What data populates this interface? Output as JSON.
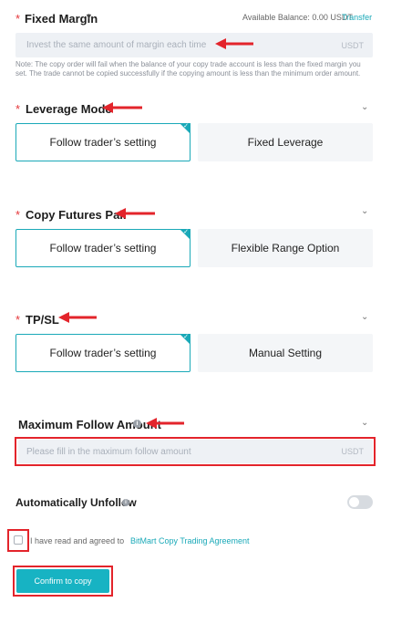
{
  "fixed_margin": {
    "label": "Fixed Margin",
    "dropdown_icon": "caret-down-icon",
    "balance_label": "Available Balance: 0.00 USDT",
    "transfer_link": "Transfer",
    "placeholder": "Invest the same amount of margin each time",
    "unit": "USDT",
    "note": "Note: The copy order will fail when the balance of your copy trade account is less than the fixed margin you set. The trade cannot be copied successfully if the copying amount is less than the minimum order amount."
  },
  "leverage_mode": {
    "label": "Leverage Mode",
    "options": [
      "Follow trader’s setting",
      "Fixed Leverage"
    ],
    "selected": 0
  },
  "copy_futures_pair": {
    "label": "Copy Futures Pair",
    "options": [
      "Follow trader’s setting",
      "Flexible Range Option"
    ],
    "selected": 0
  },
  "tpsl": {
    "label": "TP/SL",
    "options": [
      "Follow trader’s setting",
      "Manual Setting"
    ],
    "selected": 0
  },
  "max_follow": {
    "label": "Maximum Follow Amount",
    "info_icon": "info-icon",
    "placeholder": "Please fill in the maximum follow amount",
    "unit": "USDT"
  },
  "auto_unfollow": {
    "label": "Automatically Unfollow",
    "info_icon": "info-icon",
    "toggle_on": false
  },
  "agreement": {
    "text": "I have read and agreed to",
    "link": "BitMart Copy Trading Agreement",
    "checked": false
  },
  "confirm_button": "Confirm to copy",
  "colors": {
    "accent": "#1aa9b8",
    "required_star": "#e5373b",
    "annotation_red": "#e3242b"
  },
  "chevron_icon": "chevron-down-icon",
  "required_marker": "*",
  "annotation_arrow_icon": "red-arrow-icon"
}
